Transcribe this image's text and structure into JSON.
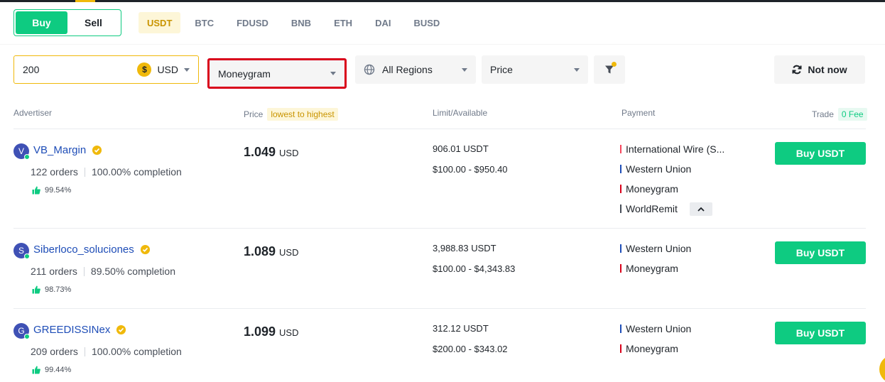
{
  "tabs": {
    "buy": "Buy",
    "sell": "Sell"
  },
  "assets": [
    "USDT",
    "BTC",
    "FDUSD",
    "BNB",
    "ETH",
    "DAI",
    "BUSD"
  ],
  "filters": {
    "amount_value": "200",
    "currency_symbol": "$",
    "currency": "USD",
    "payment": "Moneygram",
    "region": "All Regions",
    "sort": "Price",
    "not_now": "Not now"
  },
  "table_header": {
    "advertiser": "Advertiser",
    "price": "Price",
    "price_tag": "lowest to highest",
    "limit": "Limit/Available",
    "payment": "Payment",
    "trade": "Trade",
    "fee_tag": "0 Fee"
  },
  "rows": [
    {
      "initial": "V",
      "name": "VB_Margin",
      "orders": "122 orders",
      "completion": "100.00% completion",
      "rating": "99.54%",
      "price": "1.049",
      "price_unit": "USD",
      "available": "906.01 USDT",
      "limit": "$100.00 - $950.40",
      "payments": [
        "International Wire (S...",
        "Western Union",
        "Moneygram",
        "WorldRemit"
      ],
      "button": "Buy USDT"
    },
    {
      "initial": "S",
      "name": "Siberloco_soluciones",
      "orders": "211 orders",
      "completion": "89.50% completion",
      "rating": "98.73%",
      "price": "1.089",
      "price_unit": "USD",
      "available": "3,988.83 USDT",
      "limit": "$100.00 - $4,343.83",
      "payments": [
        "Western Union",
        "Moneygram"
      ],
      "button": "Buy USDT"
    },
    {
      "initial": "G",
      "name": "GREEDISSINex",
      "orders": "209 orders",
      "completion": "100.00% completion",
      "rating": "99.44%",
      "price": "1.099",
      "price_unit": "USD",
      "available": "312.12 USDT",
      "limit": "$200.00 - $343.02",
      "payments": [
        "Western Union",
        "Moneygram"
      ],
      "button": "Buy USDT"
    }
  ],
  "colors": {
    "accent_green": "#0ecb81",
    "accent_yellow": "#f0b90b",
    "highlight_red": "#d9001b",
    "payment_bar_international": "#f6465d",
    "payment_bar_western_union": "#1e4db7",
    "payment_bar_moneygram": "#d9001b",
    "payment_bar_worldremit": "#474d57"
  }
}
